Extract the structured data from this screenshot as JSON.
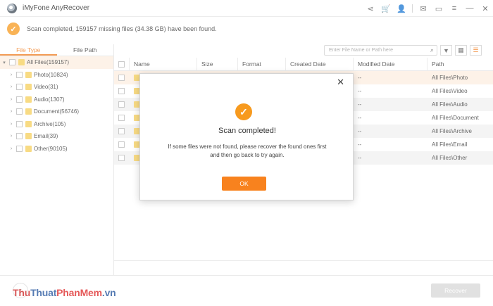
{
  "app": {
    "title": "iMyFone AnyRecover"
  },
  "status": {
    "text": "Scan completed, 159157 missing files (34.38 GB) have been found."
  },
  "left_panel": {
    "tabs": [
      {
        "label": "File Type"
      },
      {
        "label": "File Path"
      }
    ],
    "root": {
      "label": "All Files(159157)"
    },
    "items": [
      {
        "label": "Photo(10824)"
      },
      {
        "label": "Video(31)"
      },
      {
        "label": "Audio(1307)"
      },
      {
        "label": "Document(56746)"
      },
      {
        "label": "Archive(105)"
      },
      {
        "label": "Email(39)"
      },
      {
        "label": "Other(90105)"
      }
    ]
  },
  "search": {
    "placeholder": "Enter File Name or Path here"
  },
  "table": {
    "columns": [
      "Name",
      "Size",
      "Format",
      "Created Date",
      "Modified Date",
      "Path"
    ],
    "rows": [
      {
        "modified": "--",
        "path": "All Files\\Photo"
      },
      {
        "modified": "--",
        "path": "All Files\\Video"
      },
      {
        "modified": "--",
        "path": "All Files\\Audio"
      },
      {
        "modified": "--",
        "path": "All Files\\Document"
      },
      {
        "modified": "--",
        "path": "All Files\\Archive"
      },
      {
        "modified": "--",
        "path": "All Files\\Email"
      },
      {
        "modified": "--",
        "path": "All Files\\Other"
      }
    ]
  },
  "footer": {
    "recover_label": "Recover"
  },
  "watermark": {
    "part1": "Thu",
    "part2": "Thuat",
    "part3": "PhanMem",
    "part4": ".vn"
  },
  "dialog": {
    "title": "Scan completed!",
    "message": "If some files were not found, please recover the found ones first and then go back to try again.",
    "ok_label": "OK"
  },
  "colors": {
    "accent": "#f8821e",
    "highlight_row": "#fdeee0"
  }
}
